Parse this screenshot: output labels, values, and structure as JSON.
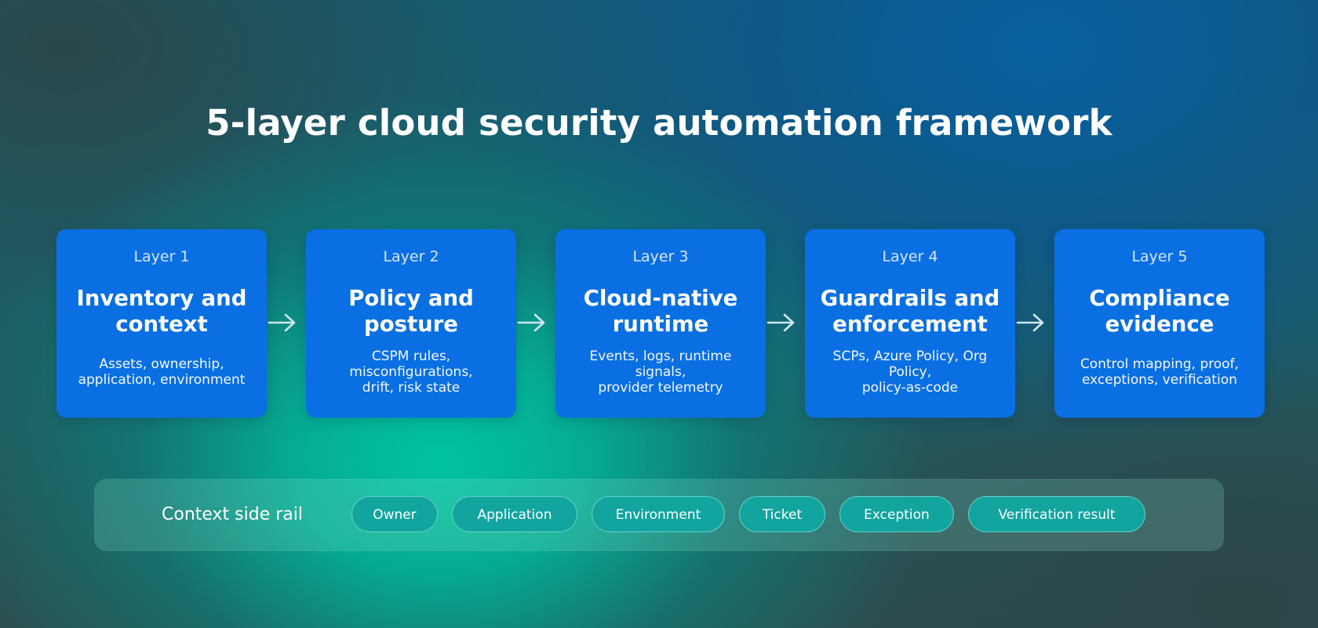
{
  "title": "5-layer cloud security automation framework",
  "layers": [
    {
      "number": "Layer 1",
      "title": "Inventory and context",
      "desc": "Assets, ownership,\napplication, environment"
    },
    {
      "number": "Layer 2",
      "title": "Policy and posture",
      "desc": "CSPM rules,\nmisconfigurations,\ndrift, risk state"
    },
    {
      "number": "Layer 3",
      "title": "Cloud-native runtime",
      "desc": "Events, logs, runtime\nsignals,\nprovider telemetry"
    },
    {
      "number": "Layer 4",
      "title": "Guardrails and enforcement",
      "desc": "SCPs, Azure Policy, Org\nPolicy,\npolicy-as-code"
    },
    {
      "number": "Layer 5",
      "title": "Compliance evidence",
      "desc": "Control mapping, proof,\nexceptions, verification"
    }
  ],
  "context_rail": {
    "label": "Context side rail",
    "chips": [
      "Owner",
      "Application",
      "Environment",
      "Ticket",
      "Exception",
      "Verification result"
    ]
  },
  "colors": {
    "card": "#0a6fe2",
    "chip": "#12a49f",
    "arrow": "#cfe6ee"
  },
  "icons": {
    "flow_arrow": "arrow-right-icon"
  }
}
